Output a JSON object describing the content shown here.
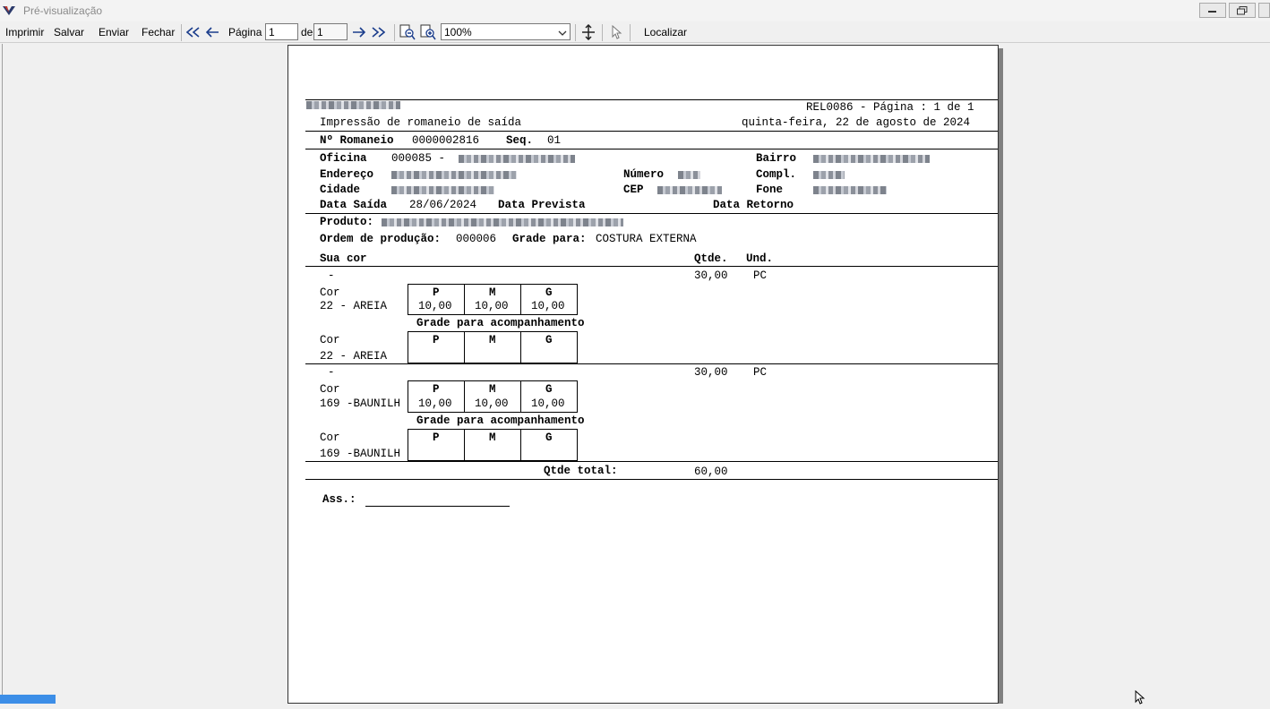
{
  "window": {
    "title": "Pré-visualização"
  },
  "toolbar": {
    "imprimir": "Imprimir",
    "salvar": "Salvar",
    "enviar": "Enviar",
    "fechar": "Fechar",
    "pagina_label": "Página",
    "pagina_value": "1",
    "de_label": "de",
    "total_pages": "1",
    "zoom_value": "100%",
    "localizar": "Localizar"
  },
  "report": {
    "header": {
      "code_page": "REL0086 - Página : 1 de 1",
      "subtitle": "Impressão de romaneio de saída",
      "date": "quinta-feira, 22 de agosto de 2024"
    },
    "romaneio": {
      "label": "Nº Romaneio",
      "value": "0000002816",
      "seq_label": "Seq.",
      "seq_value": "01"
    },
    "oficina": {
      "oficina_label": "Oficina",
      "oficina_code": "000085 -",
      "bairro_label": "Bairro",
      "endereco_label": "Endereço",
      "numero_label": "Número",
      "compl_label": "Compl.",
      "cidade_label": "Cidade",
      "cep_label": "CEP",
      "fone_label": "Fone",
      "data_saida_label": "Data Saída",
      "data_saida_value": "28/06/2024",
      "data_prevista_label": "Data Prevista",
      "data_retorno_label": "Data Retorno"
    },
    "produto": {
      "label": "Produto:",
      "ordem_label": "Ordem de produção:",
      "ordem_value": "000006",
      "grade_label": "Grade para:",
      "grade_value": "COSTURA EXTERNA"
    },
    "columns": {
      "sua_cor": "Sua cor",
      "qtde": "Qtde.",
      "und": "Und."
    },
    "items": [
      {
        "dash": "-",
        "qtde": "30,00",
        "und": "PC",
        "cor_label": "Cor",
        "cor_value": "22 - AREIA",
        "sizes": [
          "P",
          "M",
          "G"
        ],
        "values": [
          "10,00",
          "10,00",
          "10,00"
        ],
        "acomp_label": "Grade para acompanhamento"
      },
      {
        "dash": "-",
        "qtde": "30,00",
        "und": "PC",
        "cor_label": "Cor",
        "cor_value": "169 -BAUNILH",
        "sizes": [
          "P",
          "M",
          "G"
        ],
        "values": [
          "10,00",
          "10,00",
          "10,00"
        ],
        "acomp_label": "Grade para acompanhamento"
      }
    ],
    "total": {
      "label": "Qtde total:",
      "value": "60,00"
    },
    "signature": {
      "label": "Ass.:"
    }
  }
}
